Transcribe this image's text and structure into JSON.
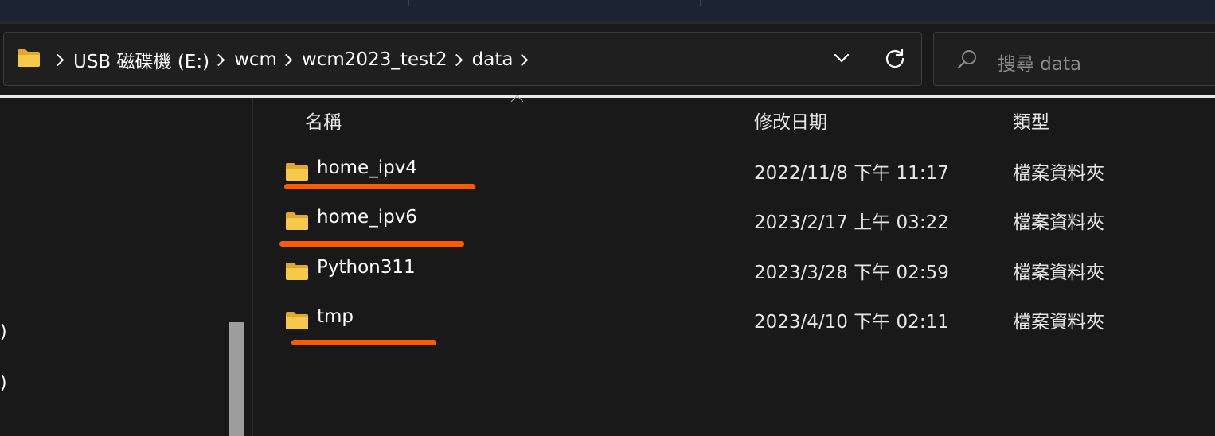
{
  "breadcrumbs": [
    "USB 磁碟機 (E:)",
    "wcm",
    "wcm2023_test2",
    "data"
  ],
  "search": {
    "placeholder": "搜尋 data"
  },
  "nav_pane": {
    "partial_items": [
      ")",
      ")"
    ]
  },
  "columns": {
    "name": "名稱",
    "date": "修改日期",
    "type": "類型"
  },
  "files": [
    {
      "name": "home_ipv4",
      "date": "2022/11/8 下午 11:17",
      "type": "檔案資料夾",
      "highlighted": true
    },
    {
      "name": "home_ipv6",
      "date": "2023/2/17 上午 03:22",
      "type": "檔案資料夾",
      "highlighted": true
    },
    {
      "name": "Python311",
      "date": "2023/3/28 下午 02:59",
      "type": "檔案資料夾",
      "highlighted": false
    },
    {
      "name": "tmp",
      "date": "2023/4/10 下午 02:11",
      "type": "檔案資料夾",
      "highlighted": true
    }
  ],
  "colors": {
    "folder": "#f7c948",
    "annotation": "#ff5a00",
    "background": "#191919"
  }
}
